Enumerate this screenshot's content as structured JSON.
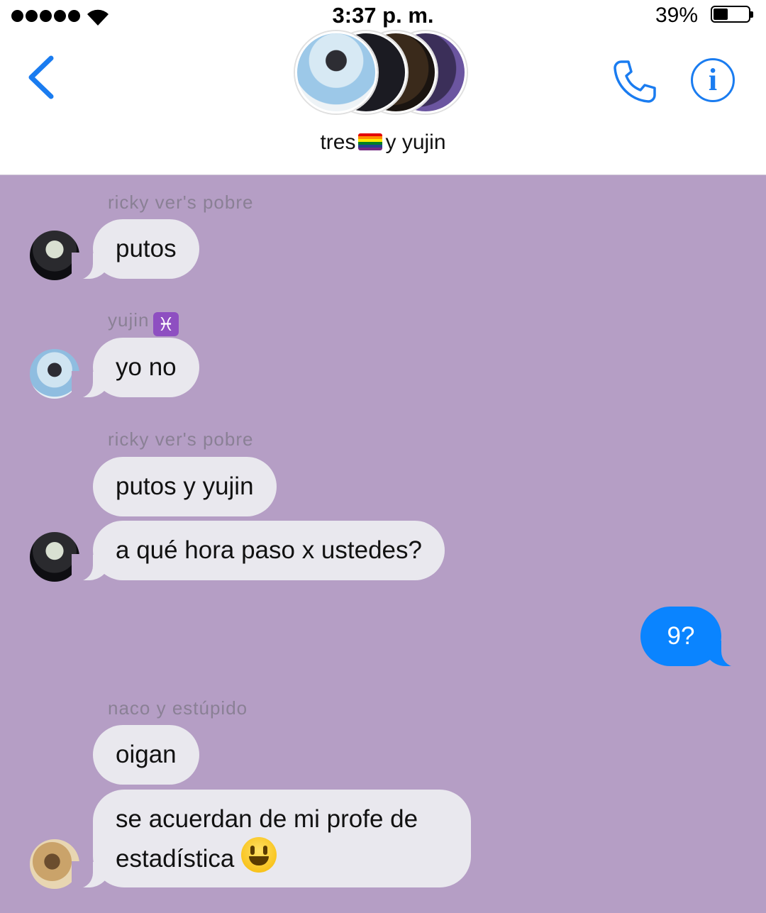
{
  "status_bar": {
    "time": "3:37 p. m.",
    "battery": "39%"
  },
  "header": {
    "group_title_start": "tres",
    "group_title_end": "y yujin",
    "back_icon": "chevron-left-icon",
    "call_icon": "phone-icon",
    "info_icon": "info-icon",
    "info_label": "i"
  },
  "colors": {
    "accent": "#0a84ff",
    "chat_background": "#b59ec5",
    "incoming_bubble": "#e9e8ee"
  },
  "messages": [
    {
      "sender": "ricky ver's pobre",
      "text": "putos"
    },
    {
      "sender": "yujin",
      "sender_emoji": "♓",
      "text": "yo no"
    },
    {
      "sender": "ricky ver's pobre",
      "text": "putos y yujin"
    },
    {
      "text": "a qué hora paso x ustedes?"
    },
    {
      "text": "9?",
      "outgoing": true
    },
    {
      "sender": "naco y estúpido",
      "text": "oigan"
    },
    {
      "text": "se acuerdan de mi profe de",
      "text_line2": "estadística"
    }
  ]
}
